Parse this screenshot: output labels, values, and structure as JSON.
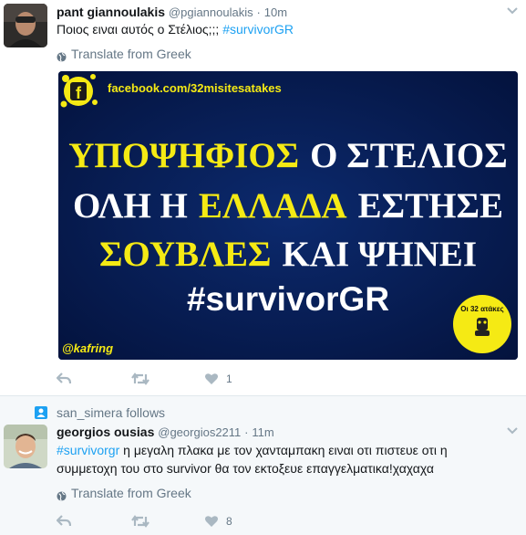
{
  "tweet1": {
    "name": "pant giannoulakis",
    "username": "@pgiannoulakis",
    "separator": "·",
    "time": "10m",
    "text_prefix": "Ποιος ειναι αυτός ο Στέλιος;;; ",
    "hashtag": "#survivorGR",
    "translate": "Translate from Greek",
    "media": {
      "fb_url": "facebook.com/32misitesatakes",
      "line1_yellow": "ΥΠΟΨΗΦΙΟΣ",
      "line1_white": "Ο ΣΤΕΛΙΟΣ",
      "line2_white_a": "ΟΛΗ Η",
      "line2_yellow": "ΕΛΛΑΔΑ",
      "line2_white_b": "ΕΣΤΗΣΕ",
      "line3_yellow": "ΣΟΥΒΛΕΣ",
      "line3_white": "ΚΑΙ ΨΗΝΕΙ",
      "line4": "#survivorGR",
      "credit": "@kafring",
      "badge": "Οι 32 ατάκες"
    },
    "like_count": "1"
  },
  "context": {
    "text": "san_simera follows"
  },
  "tweet2": {
    "name": "georgios ousias",
    "username": "@georgios2211",
    "separator": "·",
    "time": "11m",
    "hashtag": "#survivorgr",
    "text_rest": " η μεγαλη πλακα με τον χανταμπακη ειναι οτι πιστευε οτι η συμμετοχη του στο survivor θα τον εκτοξευε επαγγελματικα!χαχαχα",
    "translate": "Translate from Greek",
    "like_count": "8"
  },
  "colors": {
    "accent": "#1da1f2",
    "muted": "#657786",
    "media_bg": "#061a4a",
    "media_yellow": "#f5ea14"
  }
}
